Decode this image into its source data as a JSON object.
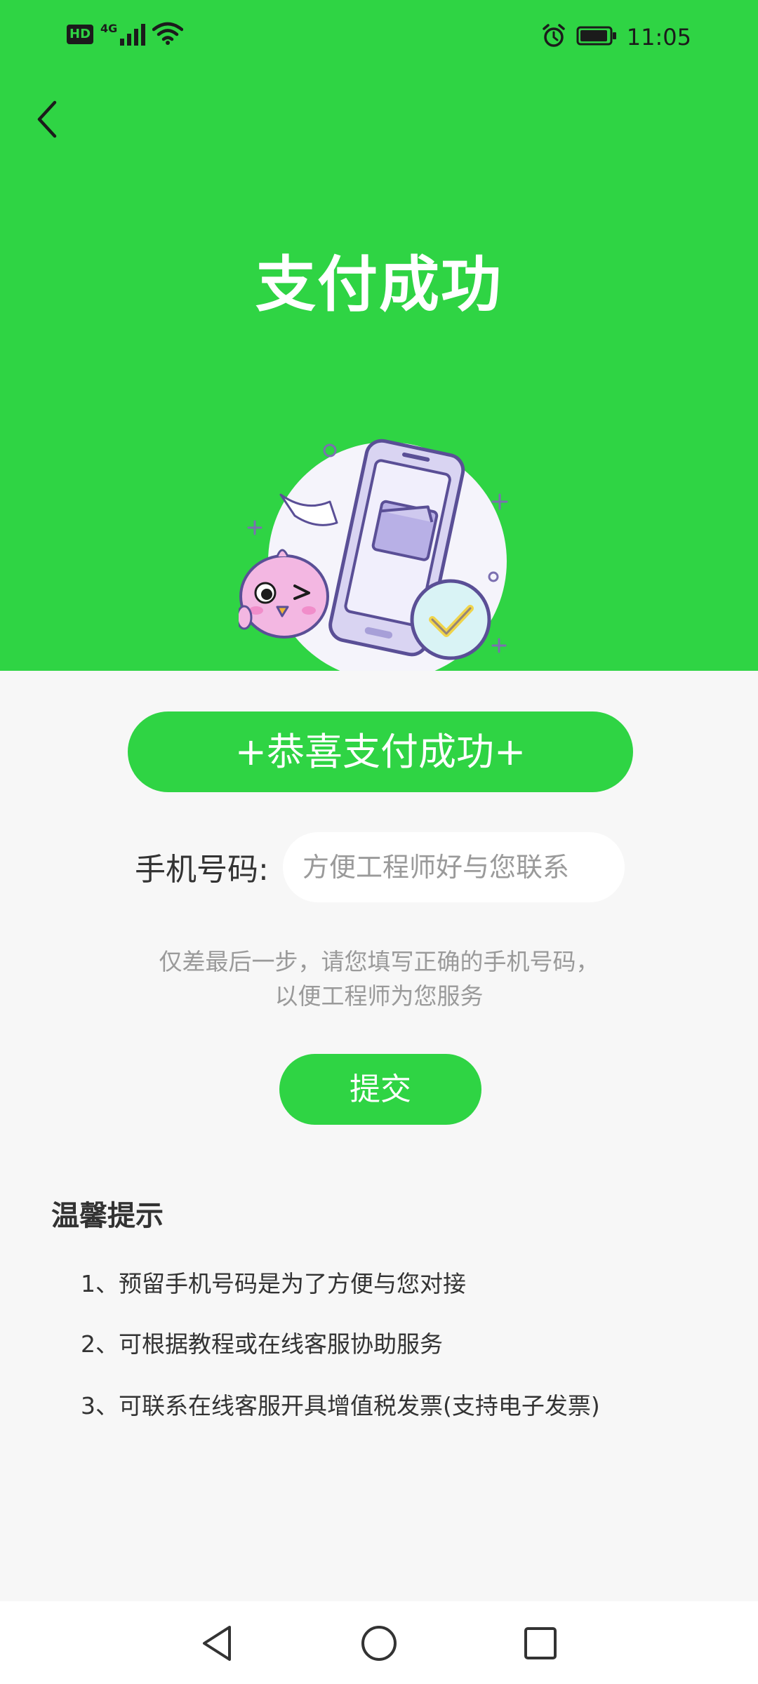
{
  "status_bar": {
    "hd_badge": "HD",
    "network_type": "4G",
    "time": "11:05",
    "icons": [
      "hd-icon",
      "signal-icon",
      "wifi-icon",
      "alarm-icon",
      "battery-icon"
    ]
  },
  "header": {
    "title": "支付成功",
    "back_icon": "back-arrow-icon",
    "background_color": "#2fd444",
    "illustration": "phone-payment-success-illustration"
  },
  "main": {
    "banner_text": "+恭喜支付成功+",
    "phone_label": "手机号码:",
    "phone_placeholder": "方便工程师好与您联系",
    "phone_value": "",
    "hint_line1": "仅差最后一步，请您填写正确的手机号码，",
    "hint_line2": "以便工程师为您服务",
    "submit_label": "提交",
    "accent_color": "#2fd444"
  },
  "tips": {
    "title": "温馨提示",
    "items": [
      "1、预留手机号码是为了方便与您对接",
      "2、可根据教程或在线客服协助服务",
      "3、可联系在线客服开具增值税发票(支持电子发票)"
    ]
  },
  "nav_bar": {
    "icons": [
      "back-triangle-icon",
      "home-circle-icon",
      "recents-square-icon"
    ]
  }
}
